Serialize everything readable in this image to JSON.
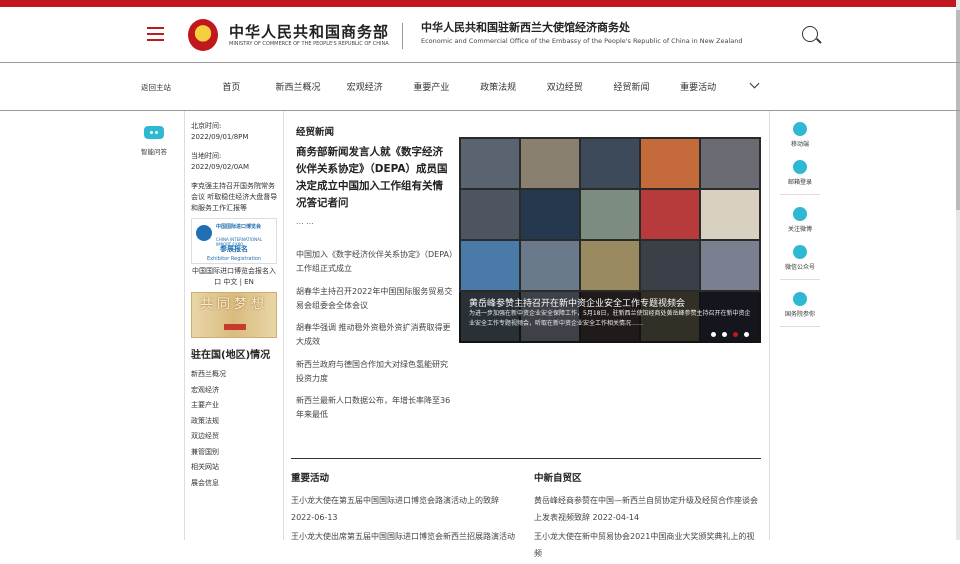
{
  "header": {
    "ministry_cn": "中华人民共和国商务部",
    "ministry_en": "MINISTRY OF COMMERCE OF THE PEOPLE'S REPUBLIC OF CHINA",
    "office_cn": "中华人民共和国驻新西兰大使馆经济商务处",
    "office_en": "Economic and Commercial Office of the Embassy of the People's Republic of China in New Zealand"
  },
  "nav": {
    "back": "返回主站",
    "items": [
      "首页",
      "新西兰概况",
      "宏观经济",
      "重要产业",
      "政策法规",
      "双边经贸",
      "经贸新闻",
      "重要活动"
    ]
  },
  "left_rail": {
    "label": "智能问答"
  },
  "sidebar": {
    "beijing_label": "北京时间:",
    "beijing_time": "2022/09/01/8PM",
    "local_label": "当地时间:",
    "local_time": "2022/09/02/0AM",
    "notice": "李克强主持召开国务院常务会议 听取稳住经济大盘督导和服务工作汇报等",
    "expo": {
      "name_cn": "中国国际进口博览会",
      "name_en": "CHINA INTERNATIONAL IMPORT EXPO",
      "reg_cn": "参展报名",
      "reg_en": "Exhibitor Registration",
      "caption": "中国国际进口博览会报名入口 中文 | EN"
    },
    "banner_text": "共同梦想",
    "section_title": "驻在国(地区)情况",
    "links": [
      "新西兰概况",
      "宏观经济",
      "主要产业",
      "政策法规",
      "双边经贸",
      "兼管国别",
      "相关网站",
      "展会信息"
    ]
  },
  "main": {
    "section_title": "经贸新闻",
    "headline": "商务部新闻发言人就《数字经济伙伴关系协定》（DEPA）成员国决定成立中国加入工作组有关情况答记者问",
    "more": "... ...",
    "news": [
      "中国加入《数字经济伙伴关系协定》（DEPA）工作组正式成立",
      "胡春华主持召开2022年中国国际服务贸易交易会组委会全体会议",
      "胡春华强调 推动稳外资稳外资扩消费取得更大成效",
      "新西兰政府与德国合作加大对绿色氢能研究投资力度",
      "新西兰最新人口数据公布，年增长率降至36年来最低"
    ]
  },
  "slider": {
    "title": "黄岳峰参赞主持召开在新中资企业安全工作专题视频会",
    "desc": "为进一步加强在新中资企业安全保障工作，5月18日，驻新西兰使馆经商处黄岳峰参赞主持召开在新中资企业安全工作专题视频会，听取在新中资企业安全工作相关情况……"
  },
  "right_rail": {
    "items": [
      "移动端",
      "邮箱登录",
      "关注微博",
      "微信公众号",
      "国务院参你"
    ]
  },
  "bottom": {
    "left_title": "重要活动",
    "left_items": [
      "王小龙大使在第五届中国国际进口博览会路演活动上的致辞 2022-06-13",
      "王小龙大使出席第五届中国国际进口博览会新西兰招展路演活动"
    ],
    "right_title": "中新自贸区",
    "right_items": [
      "黄岳峰经商参赞在中国—新西兰自贸协定升级及经贸合作座谈会上发表视频致辞 2022-04-14",
      "王小龙大使在新中贸易协会2021中国商业大奖颁奖典礼上的视频"
    ]
  },
  "colors": {
    "brand_red": "#c0181d",
    "accent_teal": "#2fb8d1"
  }
}
